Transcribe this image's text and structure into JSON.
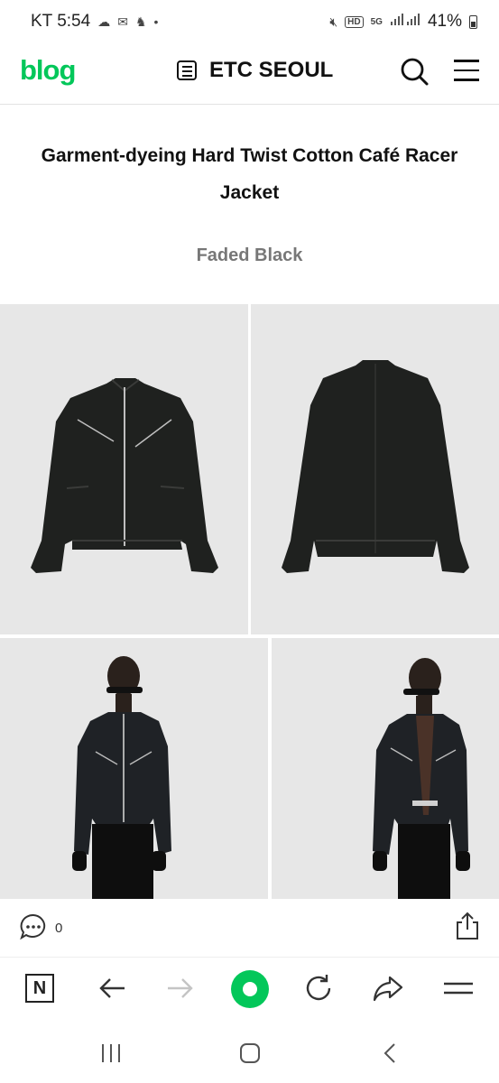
{
  "status_bar": {
    "carrier_time": "KT 5:54",
    "network": "5G",
    "hd": "HD",
    "battery": "41%"
  },
  "nav": {
    "logo": "blog",
    "blog_name": "ETC SEOUL"
  },
  "post": {
    "title": "Garment-dyeing Hard Twist Cotton Café Racer Jacket",
    "subtitle": "Faded Black"
  },
  "actions": {
    "comment_count": "0"
  },
  "browser": {
    "n_label": "N"
  },
  "colors": {
    "brand": "#03c75a",
    "photo_bg": "#e7e7e7",
    "jacket": "#1f211f",
    "subtitle": "#777777"
  },
  "photos": [
    {
      "name": "photo-jacket-front",
      "subject": "jacket front"
    },
    {
      "name": "photo-jacket-back",
      "subject": "jacket back"
    },
    {
      "name": "photo-model-front",
      "subject": "model wearing jacket zipped"
    },
    {
      "name": "photo-model-open",
      "subject": "model wearing jacket open"
    }
  ]
}
